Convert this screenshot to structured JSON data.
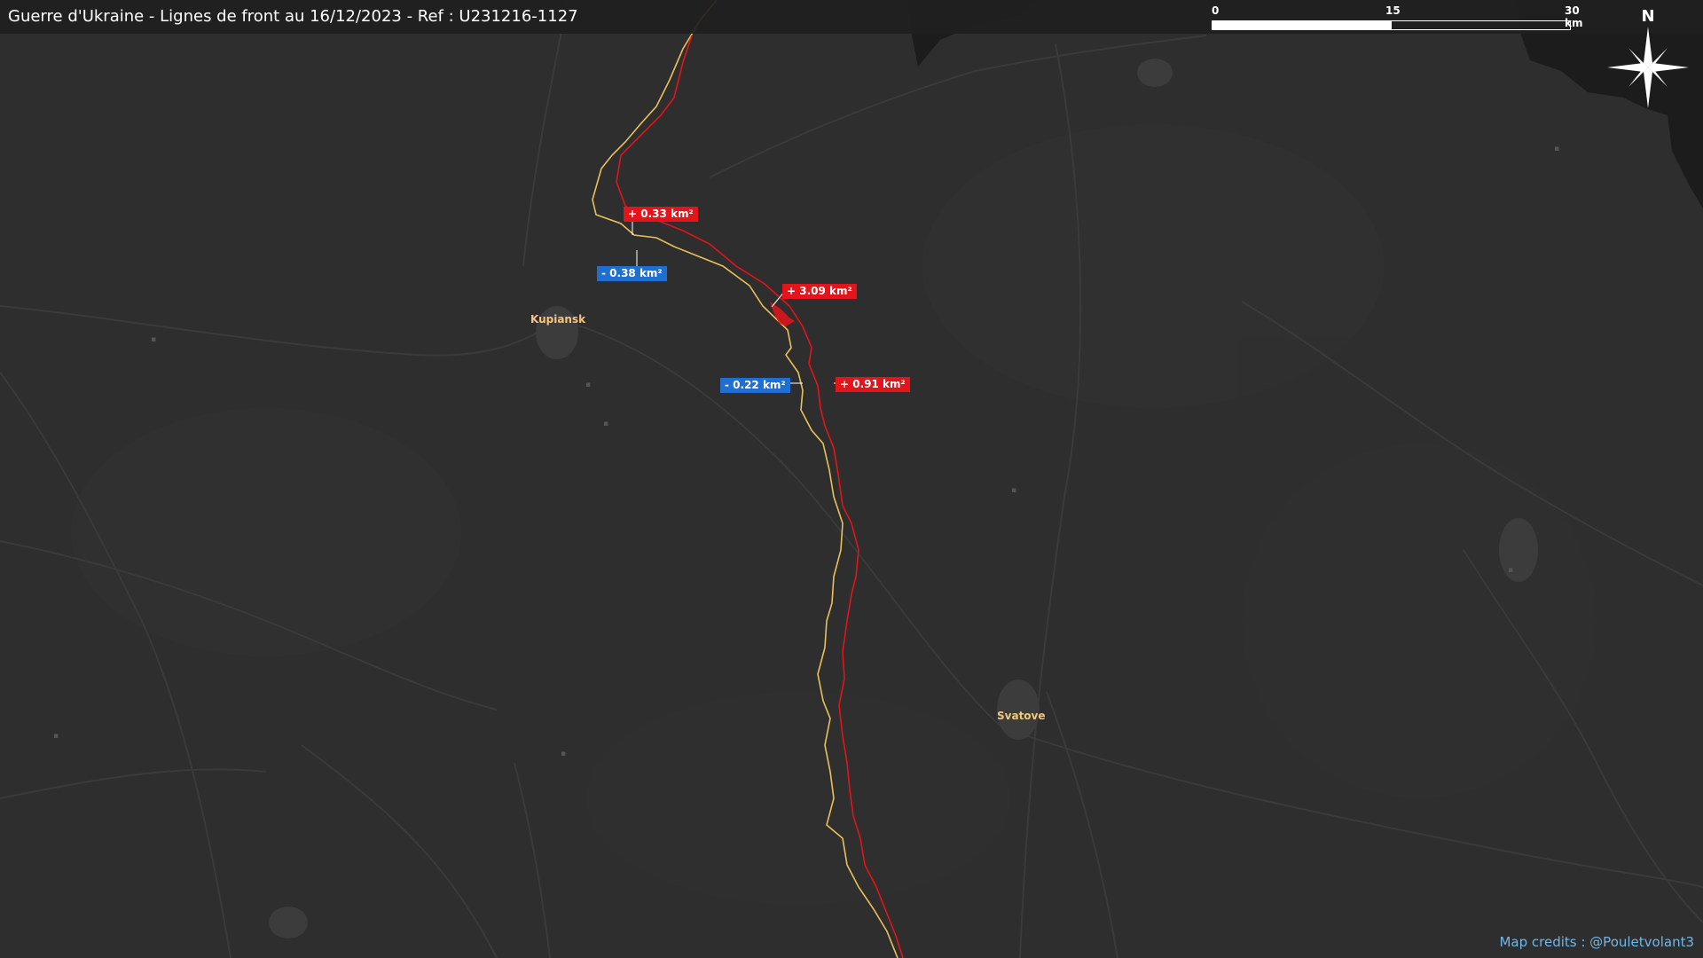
{
  "title": "Guerre d'Ukraine - Lignes de front au 16/12/2023 - Ref : U231216-1127",
  "scale": {
    "labels": [
      "0",
      "15",
      "30 km"
    ]
  },
  "compass": {
    "label": "N"
  },
  "cities": [
    "Kupiansk",
    "Svatove"
  ],
  "annotations": {
    "gain_1": "+ 0.33 km²",
    "gain_2": "+ 3.09 km²",
    "gain_3": "+ 0.91 km²",
    "loss_1": "- 0.38 km²",
    "loss_2": "- 0.22 km²"
  },
  "credits": "Map credits : @Pouletvolant3",
  "colors": {
    "background": "#2e2e2e",
    "road": "#3a3a3a",
    "occupied_line": "#e3141a",
    "ukraine_line": "#e8c15a",
    "gain": "#e3141a",
    "loss": "#1e6fd0",
    "city_label": "#f4c778",
    "credits": "#6fb7ea",
    "dark_area": "#1c1c1c"
  }
}
